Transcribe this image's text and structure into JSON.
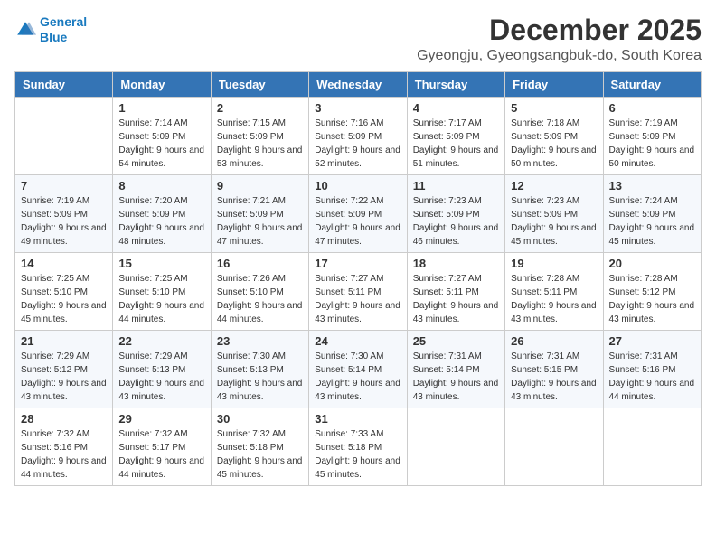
{
  "logo": {
    "line1": "General",
    "line2": "Blue"
  },
  "title": "December 2025",
  "location": "Gyeongju, Gyeongsangbuk-do, South Korea",
  "weekdays": [
    "Sunday",
    "Monday",
    "Tuesday",
    "Wednesday",
    "Thursday",
    "Friday",
    "Saturday"
  ],
  "weeks": [
    [
      {
        "day": "",
        "sunrise": "",
        "sunset": "",
        "daylight": ""
      },
      {
        "day": "1",
        "sunrise": "7:14 AM",
        "sunset": "5:09 PM",
        "daylight": "9 hours and 54 minutes."
      },
      {
        "day": "2",
        "sunrise": "7:15 AM",
        "sunset": "5:09 PM",
        "daylight": "9 hours and 53 minutes."
      },
      {
        "day": "3",
        "sunrise": "7:16 AM",
        "sunset": "5:09 PM",
        "daylight": "9 hours and 52 minutes."
      },
      {
        "day": "4",
        "sunrise": "7:17 AM",
        "sunset": "5:09 PM",
        "daylight": "9 hours and 51 minutes."
      },
      {
        "day": "5",
        "sunrise": "7:18 AM",
        "sunset": "5:09 PM",
        "daylight": "9 hours and 50 minutes."
      },
      {
        "day": "6",
        "sunrise": "7:19 AM",
        "sunset": "5:09 PM",
        "daylight": "9 hours and 50 minutes."
      }
    ],
    [
      {
        "day": "7",
        "sunrise": "7:19 AM",
        "sunset": "5:09 PM",
        "daylight": "9 hours and 49 minutes."
      },
      {
        "day": "8",
        "sunrise": "7:20 AM",
        "sunset": "5:09 PM",
        "daylight": "9 hours and 48 minutes."
      },
      {
        "day": "9",
        "sunrise": "7:21 AM",
        "sunset": "5:09 PM",
        "daylight": "9 hours and 47 minutes."
      },
      {
        "day": "10",
        "sunrise": "7:22 AM",
        "sunset": "5:09 PM",
        "daylight": "9 hours and 47 minutes."
      },
      {
        "day": "11",
        "sunrise": "7:23 AM",
        "sunset": "5:09 PM",
        "daylight": "9 hours and 46 minutes."
      },
      {
        "day": "12",
        "sunrise": "7:23 AM",
        "sunset": "5:09 PM",
        "daylight": "9 hours and 45 minutes."
      },
      {
        "day": "13",
        "sunrise": "7:24 AM",
        "sunset": "5:09 PM",
        "daylight": "9 hours and 45 minutes."
      }
    ],
    [
      {
        "day": "14",
        "sunrise": "7:25 AM",
        "sunset": "5:10 PM",
        "daylight": "9 hours and 45 minutes."
      },
      {
        "day": "15",
        "sunrise": "7:25 AM",
        "sunset": "5:10 PM",
        "daylight": "9 hours and 44 minutes."
      },
      {
        "day": "16",
        "sunrise": "7:26 AM",
        "sunset": "5:10 PM",
        "daylight": "9 hours and 44 minutes."
      },
      {
        "day": "17",
        "sunrise": "7:27 AM",
        "sunset": "5:11 PM",
        "daylight": "9 hours and 43 minutes."
      },
      {
        "day": "18",
        "sunrise": "7:27 AM",
        "sunset": "5:11 PM",
        "daylight": "9 hours and 43 minutes."
      },
      {
        "day": "19",
        "sunrise": "7:28 AM",
        "sunset": "5:11 PM",
        "daylight": "9 hours and 43 minutes."
      },
      {
        "day": "20",
        "sunrise": "7:28 AM",
        "sunset": "5:12 PM",
        "daylight": "9 hours and 43 minutes."
      }
    ],
    [
      {
        "day": "21",
        "sunrise": "7:29 AM",
        "sunset": "5:12 PM",
        "daylight": "9 hours and 43 minutes."
      },
      {
        "day": "22",
        "sunrise": "7:29 AM",
        "sunset": "5:13 PM",
        "daylight": "9 hours and 43 minutes."
      },
      {
        "day": "23",
        "sunrise": "7:30 AM",
        "sunset": "5:13 PM",
        "daylight": "9 hours and 43 minutes."
      },
      {
        "day": "24",
        "sunrise": "7:30 AM",
        "sunset": "5:14 PM",
        "daylight": "9 hours and 43 minutes."
      },
      {
        "day": "25",
        "sunrise": "7:31 AM",
        "sunset": "5:14 PM",
        "daylight": "9 hours and 43 minutes."
      },
      {
        "day": "26",
        "sunrise": "7:31 AM",
        "sunset": "5:15 PM",
        "daylight": "9 hours and 43 minutes."
      },
      {
        "day": "27",
        "sunrise": "7:31 AM",
        "sunset": "5:16 PM",
        "daylight": "9 hours and 44 minutes."
      }
    ],
    [
      {
        "day": "28",
        "sunrise": "7:32 AM",
        "sunset": "5:16 PM",
        "daylight": "9 hours and 44 minutes."
      },
      {
        "day": "29",
        "sunrise": "7:32 AM",
        "sunset": "5:17 PM",
        "daylight": "9 hours and 44 minutes."
      },
      {
        "day": "30",
        "sunrise": "7:32 AM",
        "sunset": "5:18 PM",
        "daylight": "9 hours and 45 minutes."
      },
      {
        "day": "31",
        "sunrise": "7:33 AM",
        "sunset": "5:18 PM",
        "daylight": "9 hours and 45 minutes."
      },
      {
        "day": "",
        "sunrise": "",
        "sunset": "",
        "daylight": ""
      },
      {
        "day": "",
        "sunrise": "",
        "sunset": "",
        "daylight": ""
      },
      {
        "day": "",
        "sunrise": "",
        "sunset": "",
        "daylight": ""
      }
    ]
  ]
}
